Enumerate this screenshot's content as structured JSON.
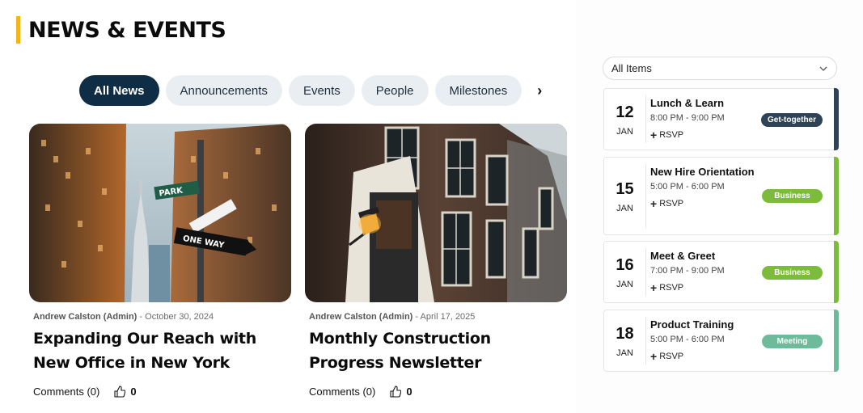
{
  "header": {
    "title": "NEWS & EVENTS",
    "accent_color": "#f2b51c"
  },
  "tabs": [
    {
      "label": "All News",
      "active": true
    },
    {
      "label": "Announcements",
      "active": false
    },
    {
      "label": "Events",
      "active": false
    },
    {
      "label": "People",
      "active": false
    },
    {
      "label": "Milestones",
      "active": false
    }
  ],
  "tabs_next_icon": "chevron-right-icon",
  "news": [
    {
      "image": "city street skyscrapers with Park and One Way signs",
      "author": "Andrew Calston (Admin)",
      "date": "October 30, 2024",
      "headline": "Expanding Our Reach with New Office in New York",
      "comments_label": "Comments (0)",
      "likes": "0"
    },
    {
      "image": "brick building facade with street lamp",
      "author": "Andrew Calston (Admin)",
      "date": "April 17, 2025",
      "headline": "Monthly Construction Progress Newsletter",
      "comments_label": "Comments (0)",
      "likes": "0"
    }
  ],
  "filter": {
    "selected": "All Items",
    "icon": "chevron-down-icon"
  },
  "events": [
    {
      "day": "12",
      "month": "JAN",
      "name": "Lunch & Learn",
      "time": "8:00 PM - 9:00 PM",
      "rsvp": "RSVP",
      "badge": "Get-together",
      "color": "#2e4356"
    },
    {
      "day": "15",
      "month": "JAN",
      "name": "New Hire Orientation",
      "time": "5:00 PM - 6:00 PM",
      "rsvp": "RSVP",
      "badge": "Business",
      "color": "#7dbb3c"
    },
    {
      "day": "16",
      "month": "JAN",
      "name": "Meet & Greet",
      "time": "7:00 PM - 9:00 PM",
      "rsvp": "RSVP",
      "badge": "Business",
      "color": "#7dbb3c"
    },
    {
      "day": "18",
      "month": "JAN",
      "name": "Product Training",
      "time": "5:00 PM - 6:00 PM",
      "rsvp": "RSVP",
      "badge": "Meeting",
      "color": "#6dbb9a"
    }
  ]
}
